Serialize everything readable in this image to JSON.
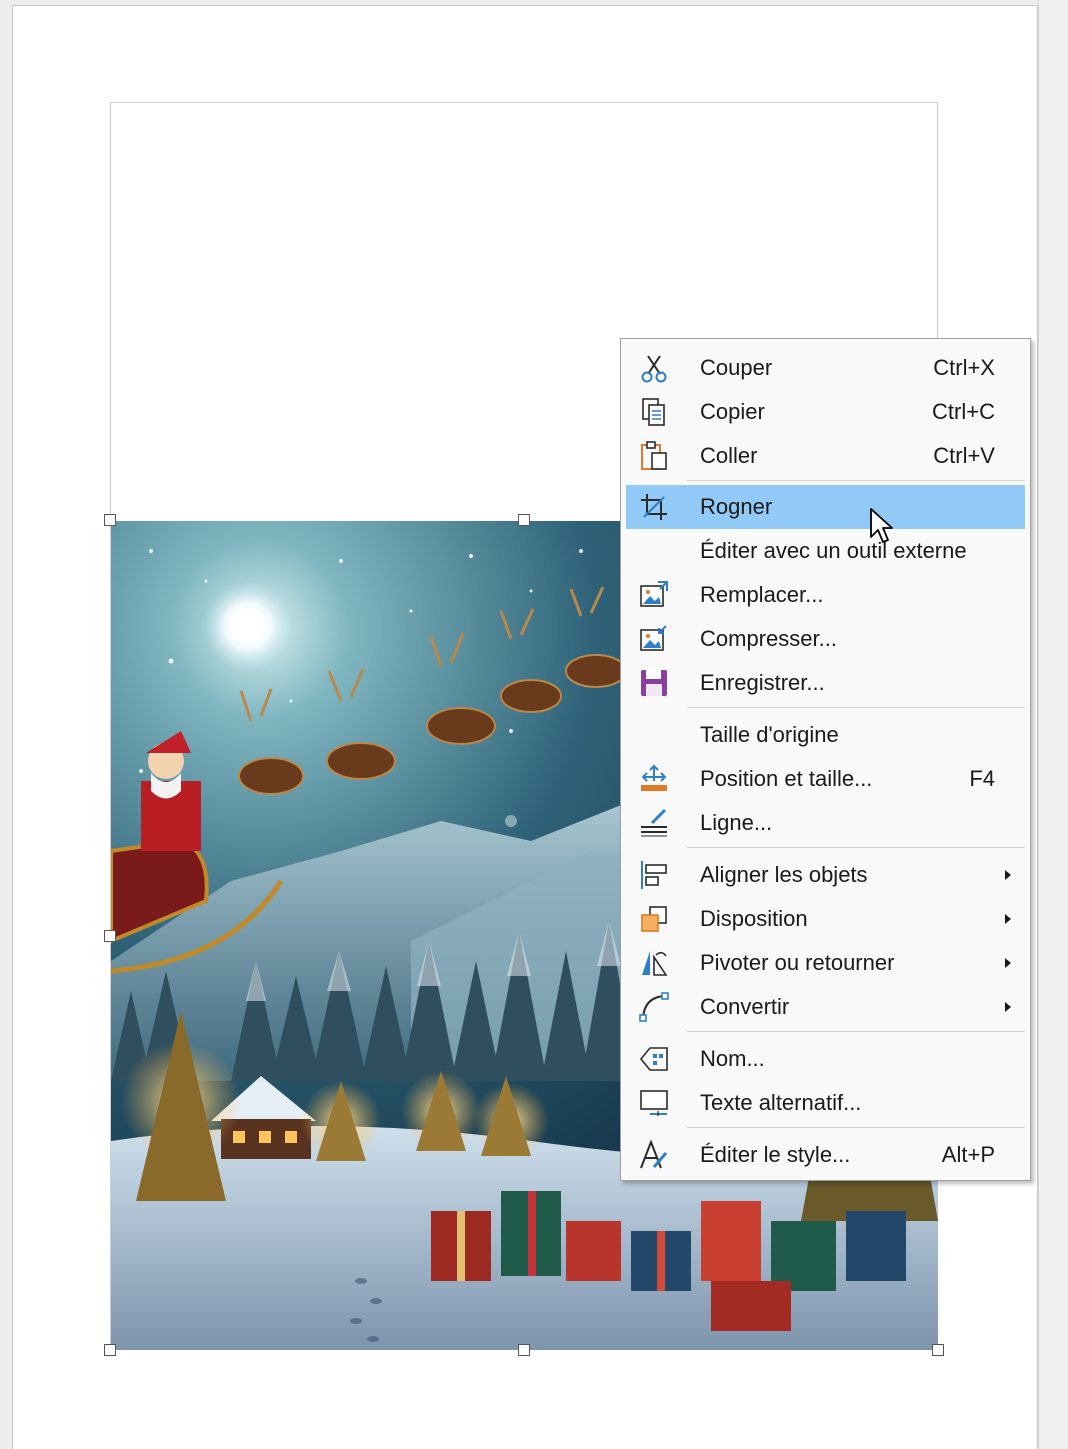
{
  "context_menu": {
    "items": [
      {
        "label": "Couper",
        "shortcut": "Ctrl+X",
        "icon": "scissors-icon"
      },
      {
        "label": "Copier",
        "shortcut": "Ctrl+C",
        "icon": "copy-icon"
      },
      {
        "label": "Coller",
        "shortcut": "Ctrl+V",
        "icon": "paste-icon"
      },
      {
        "label": "Rogner",
        "shortcut": "",
        "icon": "crop-icon",
        "highlighted": true
      },
      {
        "label": "Éditer avec un outil externe",
        "shortcut": "",
        "icon": ""
      },
      {
        "label": "Remplacer...",
        "shortcut": "",
        "icon": "replace-image-icon"
      },
      {
        "label": "Compresser...",
        "shortcut": "",
        "icon": "compress-image-icon"
      },
      {
        "label": "Enregistrer...",
        "shortcut": "",
        "icon": "save-icon"
      },
      {
        "label": "Taille d'origine",
        "shortcut": "",
        "icon": ""
      },
      {
        "label": "Position et taille...",
        "shortcut": "F4",
        "icon": "position-size-icon"
      },
      {
        "label": "Ligne...",
        "shortcut": "",
        "icon": "line-icon"
      },
      {
        "label": "Aligner les objets",
        "shortcut": "",
        "icon": "align-objects-icon",
        "submenu": true
      },
      {
        "label": "Disposition",
        "shortcut": "",
        "icon": "arrange-icon",
        "submenu": true
      },
      {
        "label": "Pivoter ou retourner",
        "shortcut": "",
        "icon": "rotate-flip-icon",
        "submenu": true
      },
      {
        "label": "Convertir",
        "shortcut": "",
        "icon": "convert-curve-icon",
        "submenu": true
      },
      {
        "label": "Nom...",
        "shortcut": "",
        "icon": "name-tag-icon"
      },
      {
        "label": "Texte alternatif...",
        "shortcut": "",
        "icon": "alt-text-icon"
      },
      {
        "label": "Éditer le style...",
        "shortcut": "Alt+P",
        "icon": "edit-style-icon"
      }
    ]
  },
  "colors": {
    "highlight": "#91c9f7",
    "menu_background": "#f9f9f9",
    "accent_blue": "#2f7fc8",
    "accent_orange": "#e07a28",
    "accent_purple": "#8a3fa0"
  }
}
